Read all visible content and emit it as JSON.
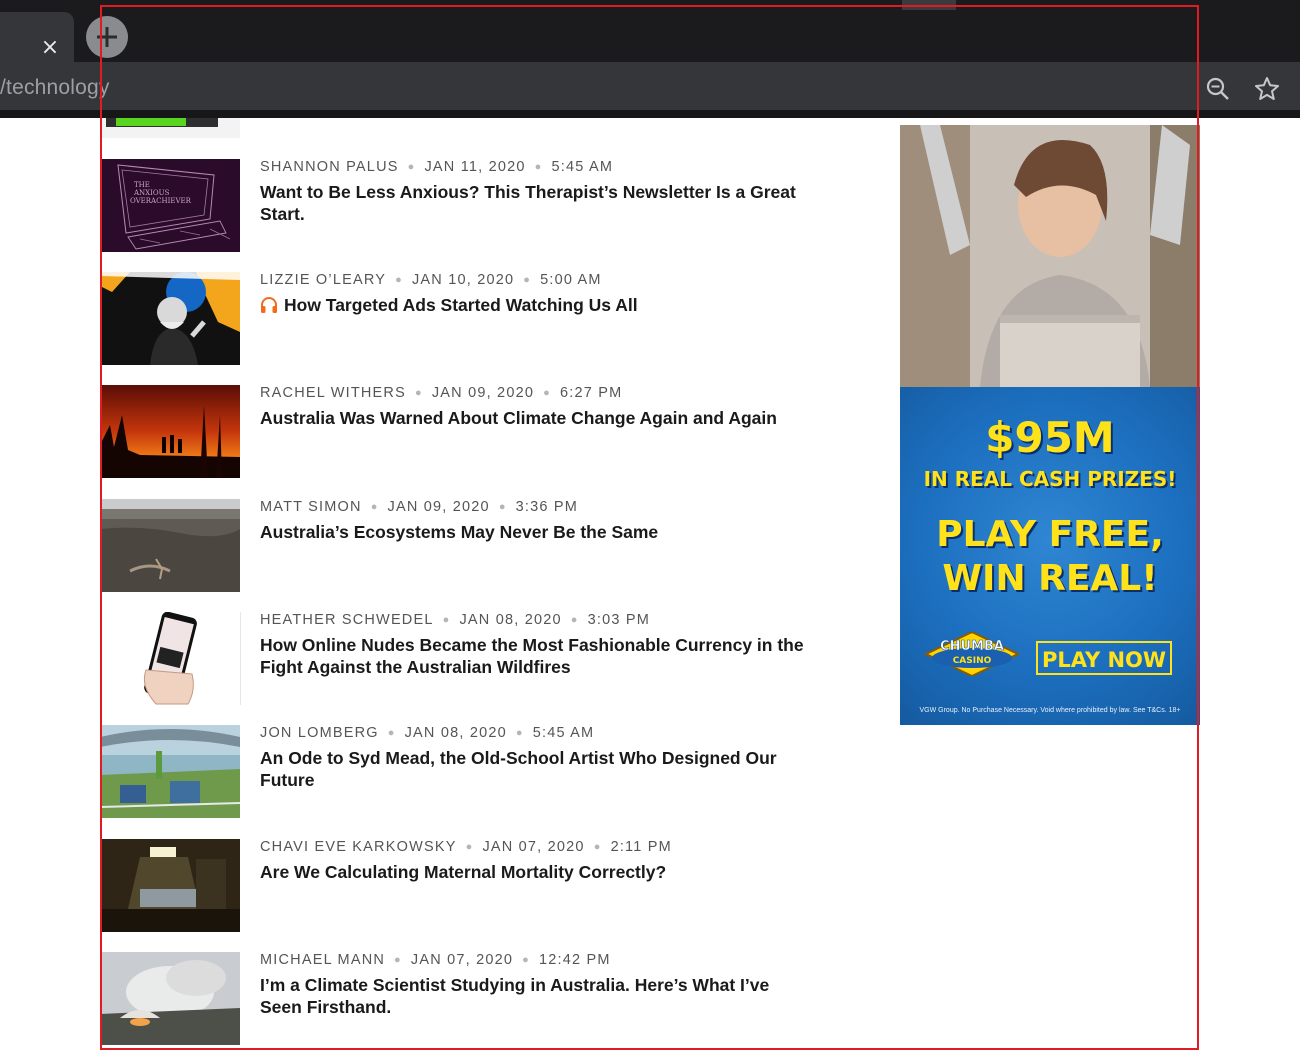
{
  "browser": {
    "url": "/technology",
    "tab_close_label": "×",
    "icons": [
      "close-icon",
      "plus-icon",
      "zoom-out-icon",
      "star-icon"
    ]
  },
  "articles": [
    {
      "author": "SHANNON PALUS",
      "date": "JAN 11, 2020",
      "time": "5:45 AM",
      "title": "Want to Be Less Anxious? This Therapist’s Newsletter Is a Great Start.",
      "audio": false,
      "thumb_label": "The Anxious Overachiever"
    },
    {
      "author": "LIZZIE O’LEARY",
      "date": "JAN 10, 2020",
      "time": "5:00 AM",
      "title": "How Targeted Ads Started Watching Us All",
      "audio": true
    },
    {
      "author": "RACHEL WITHERS",
      "date": "JAN 09, 2020",
      "time": "6:27 PM",
      "title": "Australia Was Warned About Climate Change Again and Again",
      "audio": false
    },
    {
      "author": "MATT SIMON",
      "date": "JAN 09, 2020",
      "time": "3:36 PM",
      "title": "Australia’s Ecosystems May Never Be the Same",
      "audio": false
    },
    {
      "author": "HEATHER SCHWEDEL",
      "date": "JAN 08, 2020",
      "time": "3:03 PM",
      "title": "How Online Nudes Became the Most Fashionable Currency in the Fight Against the Australian Wildfires",
      "audio": false
    },
    {
      "author": "JON LOMBERG",
      "date": "JAN 08, 2020",
      "time": "5:45 AM",
      "title": "An Ode to Syd Mead, the Old-School Artist Who Designed Our Future",
      "audio": false
    },
    {
      "author": "CHAVI EVE KARKOWSKY",
      "date": "JAN 07, 2020",
      "time": "2:11 PM",
      "title": "Are We Calculating Maternal Mortality Correctly?",
      "audio": false
    },
    {
      "author": "MICHAEL MANN",
      "date": "JAN 07, 2020",
      "time": "12:42 PM",
      "title": "I’m a Climate Scientist Studying in Australia. Here’s What I’ve Seen Firsthand.",
      "audio": false
    }
  ],
  "ad": {
    "amount": "$95M",
    "prizes": "IN REAL CASH PRIZES!",
    "play_line1": "PLAY FREE,",
    "play_line2": "WIN REAL!",
    "logo_top": "CHUMBA",
    "logo_bottom": "CASINO",
    "button": "PLAY NOW",
    "fine_print": "VGW Group. No Purchase Necessary. Void where prohibited by law. See T&Cs. 18+",
    "colors": {
      "blue": "#1c6fbf",
      "yellow": "#ffe21a"
    }
  },
  "colors": {
    "headline": "#1a1a1a",
    "meta": "#555555",
    "audio_icon": "#f26b1d",
    "frame": "#e01b22"
  }
}
